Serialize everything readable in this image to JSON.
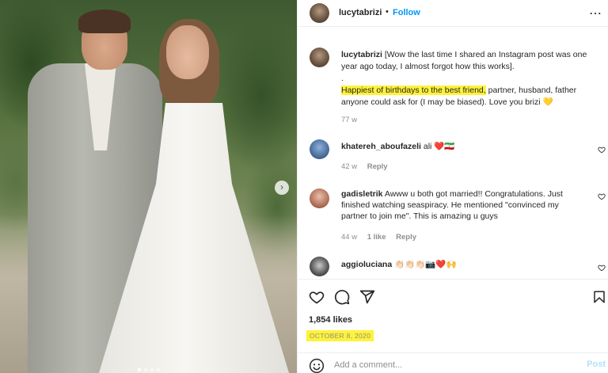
{
  "post": {
    "username": "lucytabrizi",
    "separator": "•",
    "follow_label": "Follow",
    "more_icon": "⋯"
  },
  "caption": {
    "username": "lucytabrizi",
    "text_before": "[Wow the last time I shared an Instagram post was one year ago today, I almost forgot how this works].",
    "period": ".",
    "highlight": "Happiest of birthdays to the best friend,",
    "text_after": " partner, husband, father anyone could ask for (I may be biased). Love you brizi",
    "emoji": "💛",
    "time": "77 w"
  },
  "comments": [
    {
      "username": "khatereh_aboufazeli",
      "text": "ali ❤️🇮🇷",
      "time": "42 w",
      "likes": "",
      "reply": "Reply"
    },
    {
      "username": "gadisletrik",
      "text": "Awww u both got married!! Congratulations. Just finished watching seaspiracy. He mentioned \"convinced my partner to join me\". This is amazing u guys",
      "time": "44 w",
      "likes": "1 like",
      "reply": "Reply"
    },
    {
      "username": "aggioluciana",
      "text": "👏🏻👏🏻👏🏻📷❤️🙌",
      "time": "",
      "likes": "",
      "reply": ""
    }
  ],
  "stats": {
    "likes": "1,854 likes",
    "date": "OCTOBER 8, 2020"
  },
  "comment_box": {
    "placeholder": "Add a comment...",
    "post_label": "Post"
  },
  "colors": {
    "follow": "#0095f6",
    "highlight": "#fff23a",
    "post_disabled": "#b2dffc"
  },
  "carousel": {
    "next_icon": "›"
  }
}
